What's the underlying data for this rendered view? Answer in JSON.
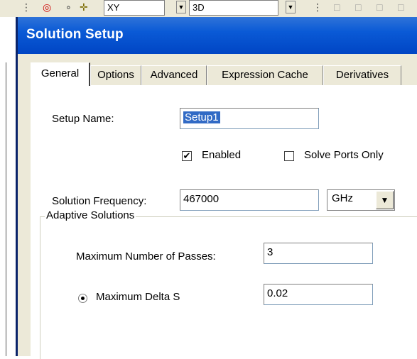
{
  "toolbar": {
    "xy_label": "XY",
    "threeD_label": "3D"
  },
  "dialog": {
    "title": "Solution Setup",
    "tabs": [
      {
        "label": "General",
        "active": true
      },
      {
        "label": "Options",
        "active": false
      },
      {
        "label": "Advanced",
        "active": false
      },
      {
        "label": "Expression Cache",
        "active": false
      },
      {
        "label": "Derivatives",
        "active": false
      }
    ],
    "general": {
      "setup_name_label": "Setup Name:",
      "setup_name_value": "Setup1",
      "enabled_label": "Enabled",
      "enabled_checked": true,
      "solve_ports_label": "Solve Ports Only",
      "solve_ports_checked": false,
      "freq_label": "Solution Frequency:",
      "freq_value": "467000",
      "freq_unit": "GHz",
      "adaptive_group_title": "Adaptive Solutions",
      "max_passes_label": "Maximum Number of Passes:",
      "max_passes_value": "3",
      "max_delta_label": "Maximum Delta S",
      "max_delta_value": "0.02",
      "max_delta_selected": true
    }
  },
  "colors": {
    "titlebar": "#0a5ad6",
    "dialog_bg": "#ece9d8",
    "selection": "#316ac5"
  }
}
